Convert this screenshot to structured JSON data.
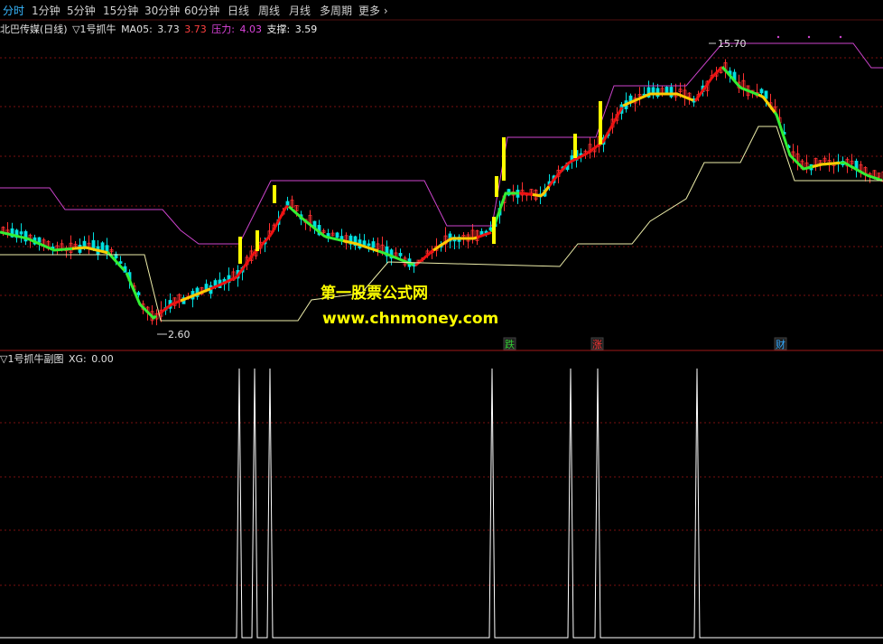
{
  "toolbar": {
    "tabs": [
      "分时",
      "1分钟",
      "5分钟",
      "15分钟",
      "30分钟",
      "60分钟",
      "日线",
      "周线",
      "月线",
      "多周期",
      "更多"
    ],
    "active_index": 0
  },
  "main_chart": {
    "stock_title": "北巴传媒(日线)",
    "indicator_name": "▽1号抓牛",
    "ma_label": "MA05:",
    "ma_value": "3.73",
    "ma_value2": "3.73",
    "resistance_label": "压力:",
    "resistance_value": "4.03",
    "support_label": "支撑:",
    "support_value": "3.59",
    "high_marker": "15.70",
    "low_marker": "2.60",
    "events": [
      "跌",
      "涨",
      "财"
    ]
  },
  "sub_chart": {
    "title": "▽1号抓牛副图",
    "xg_label": "XG:",
    "xg_value": "0.00"
  },
  "watermark": {
    "line1": "第一股票公式网",
    "line2": "www.chnmoney.com"
  },
  "colors": {
    "background": "#000000",
    "grid": "#7a1010",
    "up": "#ff3030",
    "down": "#00e0e0",
    "green_line": "#33ee33",
    "red_line": "#ee1111",
    "yellow_line": "#ffcc00",
    "resistance": "#cc44cc",
    "support": "#eeeeaa",
    "signal_bar": "#ffff00",
    "subchart_line": "#ffffff"
  }
}
